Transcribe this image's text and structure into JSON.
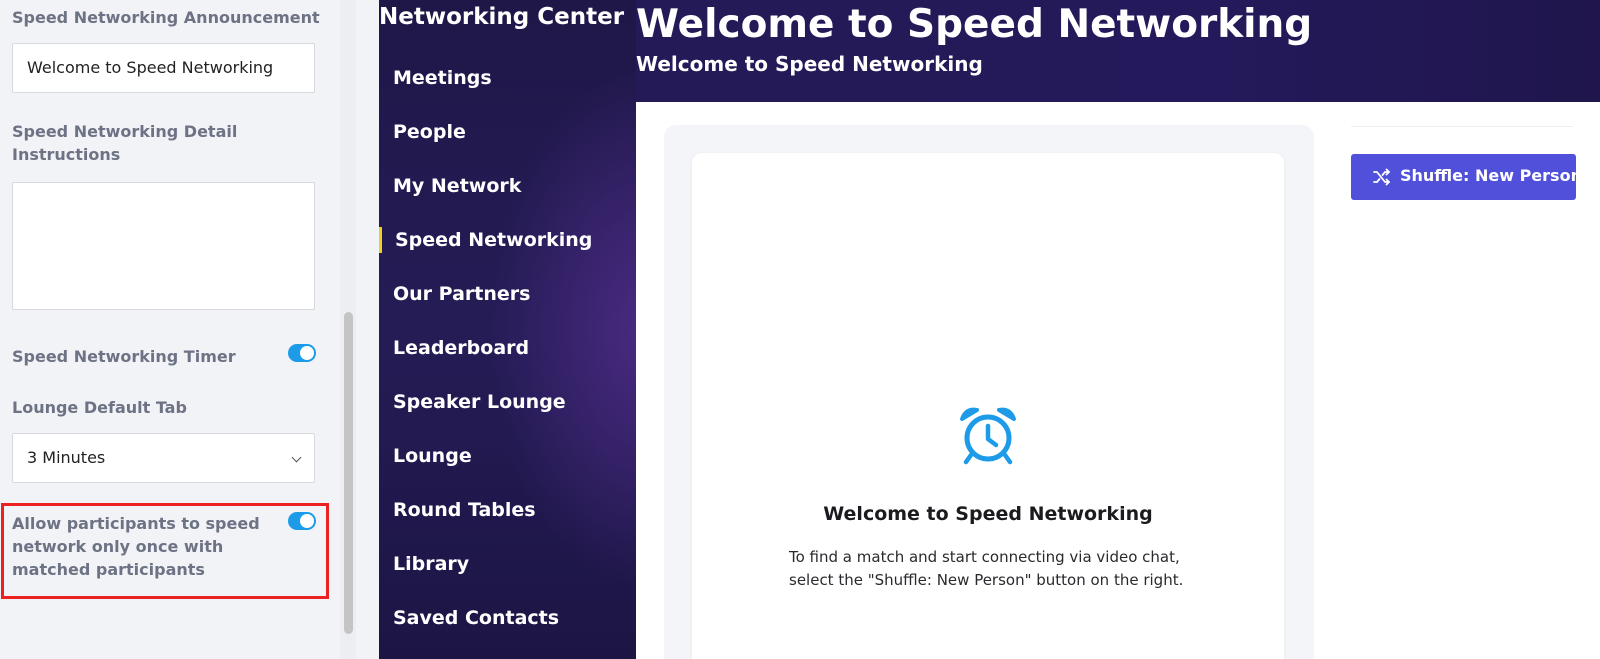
{
  "settings": {
    "announcement_label": "Speed Networking Announcement",
    "announcement_value": "Welcome to Speed Networking",
    "detail_label_line1": "Speed Networking Detail",
    "detail_label_line2": "Instructions",
    "detail_value": "",
    "timer_label": "Speed Networking Timer",
    "timer_enabled": true,
    "lounge_tab_label": "Lounge Default Tab",
    "lounge_tab_value": "3 Minutes",
    "allow_once_label_line1": "Allow participants to speed",
    "allow_once_label_line2": "network only once with",
    "allow_once_label_line3": "matched participants",
    "allow_once_enabled": true
  },
  "nav": {
    "title": "Networking Center",
    "items": [
      {
        "label": "Meetings",
        "active": false
      },
      {
        "label": "People",
        "active": false
      },
      {
        "label": "My Network",
        "active": false
      },
      {
        "label": "Speed Networking",
        "active": true
      },
      {
        "label": "Our Partners",
        "active": false
      },
      {
        "label": "Leaderboard",
        "active": false
      },
      {
        "label": "Speaker Lounge",
        "active": false
      },
      {
        "label": "Lounge",
        "active": false
      },
      {
        "label": "Round Tables",
        "active": false
      },
      {
        "label": "Library",
        "active": false
      },
      {
        "label": "Saved Contacts",
        "active": false
      }
    ],
    "active_color": "#f2d11e"
  },
  "main": {
    "title": "Welcome to Speed Networking",
    "subtitle": "Welcome to Speed Networking",
    "card": {
      "icon": "alarm-clock-icon",
      "title": "Welcome to Speed Networking",
      "desc_line1": "To find a match and start connecting via video chat,",
      "desc_line2": "select the \"Shuffle: New Person\" button on the right."
    },
    "shuffle_button": {
      "icon": "shuffle-icon",
      "label": "Shuffle: New Person"
    }
  },
  "colors": {
    "accent": "#5150db",
    "toggle": "#1e9be8",
    "nav_bg": "#1f1748",
    "highlight": "#ec2222"
  }
}
